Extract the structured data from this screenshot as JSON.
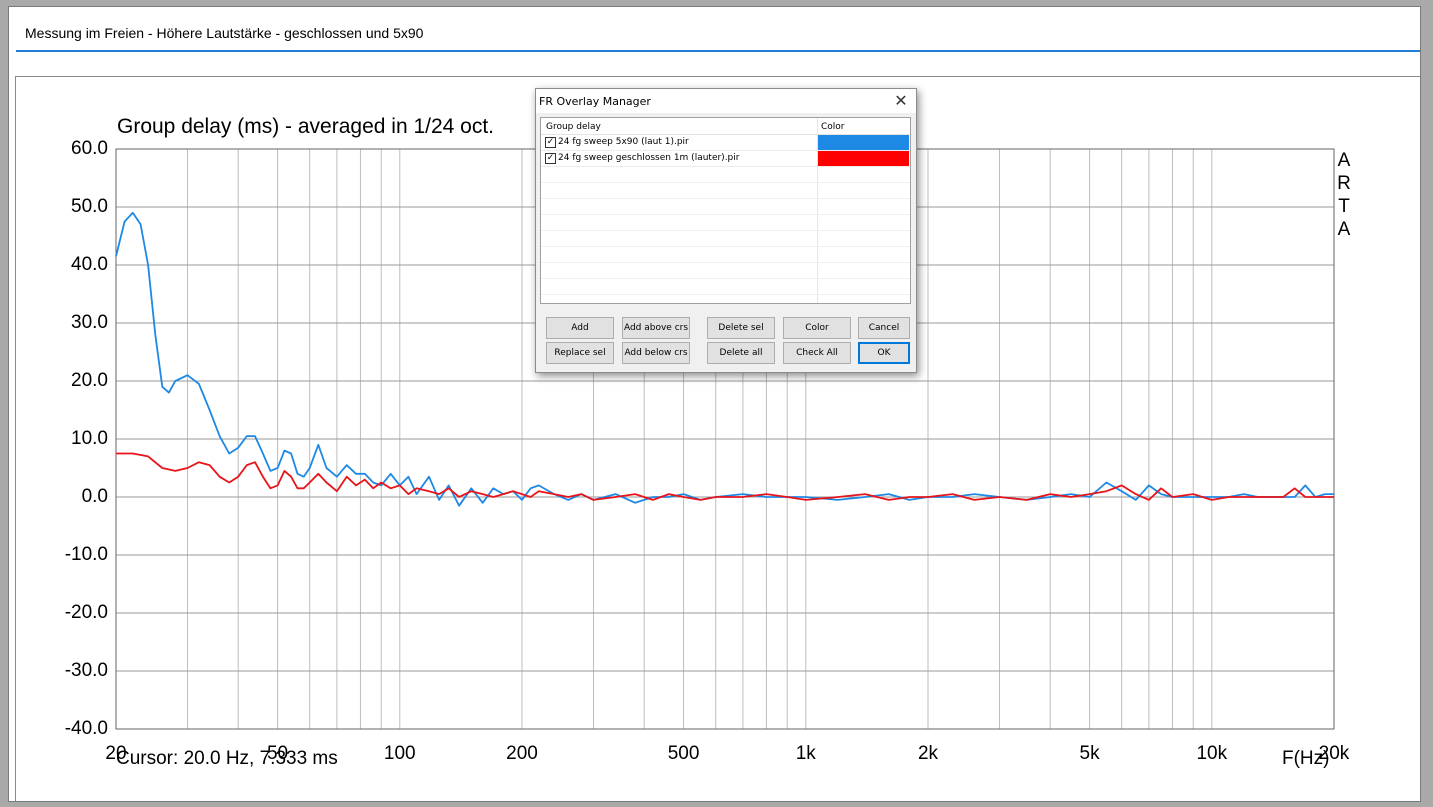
{
  "document": {
    "title": "Messung im Freien - Höhere Lautstärke - geschlossen und 5x90"
  },
  "chart_data": {
    "type": "line",
    "title": "Group delay (ms) - averaged in 1/24 oct.",
    "xlabel": "F(Hz)",
    "ylabel": "",
    "xscale": "log",
    "xlim": [
      20,
      20000
    ],
    "ylim": [
      -40,
      60
    ],
    "grid": true,
    "watermark": "ARTA",
    "yticks": [
      "60.0",
      "50.0",
      "40.0",
      "30.0",
      "20.0",
      "10.0",
      "0.0",
      "-10.0",
      "-20.0",
      "-30.0",
      "-40.0"
    ],
    "xtick_labels": [
      "20",
      "50",
      "100",
      "200",
      "500",
      "1k",
      "2k",
      "5k",
      "10k",
      "20k"
    ],
    "series": [
      {
        "color": "#1e88e5",
        "x": [
          20,
          21,
          22,
          23,
          24,
          25,
          26,
          27,
          28,
          30,
          32,
          34,
          36,
          38,
          40,
          42,
          44,
          46,
          48,
          50,
          52,
          54,
          56,
          58,
          60,
          63,
          66,
          70,
          74,
          78,
          82,
          86,
          90,
          95,
          100,
          105,
          110,
          118,
          125,
          132,
          140,
          150,
          160,
          170,
          180,
          190,
          200,
          210,
          220,
          240,
          260,
          280,
          300,
          340,
          380,
          420,
          460,
          500,
          550,
          600,
          700,
          800,
          900,
          1000,
          1200,
          1400,
          1600,
          1800,
          2000,
          2300,
          2600,
          3000,
          3500,
          4000,
          4500,
          5000,
          5500,
          6000,
          6500,
          7000,
          7500,
          8000,
          9000,
          10000,
          11000,
          12000,
          13000,
          14000,
          15000,
          16000,
          17000,
          18000,
          19000,
          20000
        ],
        "y": [
          41.5,
          47.5,
          49,
          47,
          40,
          28,
          19,
          18,
          20,
          21,
          19.5,
          15,
          10.5,
          7.5,
          8.5,
          10.5,
          10.5,
          7.5,
          4.5,
          5,
          8,
          7.5,
          4,
          3.5,
          5,
          9,
          5,
          3.5,
          5.5,
          4,
          4,
          2.5,
          2,
          4,
          2,
          3.5,
          0.5,
          3.5,
          -0.5,
          2,
          -1.5,
          1.5,
          -1,
          1.5,
          0.5,
          1,
          -0.5,
          1.5,
          2,
          0.5,
          -0.5,
          0.5,
          -0.5,
          0.5,
          -1,
          0,
          0,
          0.5,
          -0.5,
          0,
          0.5,
          0,
          0,
          0,
          -0.5,
          0,
          0.5,
          -0.5,
          0,
          0,
          0.5,
          0,
          -0.5,
          0,
          0.5,
          0,
          2.5,
          1,
          -0.5,
          2,
          0.5,
          0,
          0,
          0,
          0,
          0.5,
          0,
          0,
          0,
          0,
          2,
          0,
          0.5,
          0.5
        ]
      },
      {
        "color": "#e8141a",
        "x": [
          20,
          22,
          24,
          26,
          28,
          30,
          32,
          34,
          36,
          38,
          40,
          42,
          44,
          46,
          48,
          50,
          52,
          54,
          56,
          58,
          60,
          63,
          66,
          70,
          74,
          78,
          82,
          86,
          90,
          95,
          100,
          105,
          110,
          118,
          125,
          132,
          140,
          150,
          160,
          170,
          180,
          190,
          200,
          210,
          220,
          240,
          260,
          280,
          300,
          340,
          380,
          420,
          460,
          500,
          550,
          600,
          700,
          800,
          900,
          1000,
          1200,
          1400,
          1600,
          1800,
          2000,
          2300,
          2600,
          3000,
          3500,
          4000,
          4500,
          5000,
          5500,
          6000,
          6500,
          7000,
          7500,
          8000,
          9000,
          10000,
          11000,
          12000,
          13000,
          14000,
          15000,
          16000,
          17000,
          18000,
          19000,
          20000
        ],
        "y": [
          7.5,
          7.5,
          7,
          5,
          4.5,
          5,
          6,
          5.5,
          3.5,
          2.5,
          3.5,
          5.5,
          6,
          3.5,
          1.5,
          2,
          4.5,
          3.5,
          1.5,
          1.5,
          2.5,
          4,
          2.5,
          1,
          3.5,
          2,
          3,
          1.5,
          2.5,
          1.5,
          2,
          0.5,
          1.5,
          1,
          0.5,
          1.5,
          0,
          1,
          0.5,
          0,
          0.5,
          1,
          0.5,
          0,
          1,
          0.5,
          0,
          0.5,
          -0.5,
          0,
          0.5,
          -0.5,
          0.5,
          0,
          -0.5,
          0,
          0,
          0.5,
          0,
          -0.5,
          0,
          0.5,
          -0.5,
          0,
          0,
          0.5,
          -0.5,
          0,
          -0.5,
          0.5,
          0,
          0.5,
          1,
          2,
          0.5,
          -0.5,
          1.5,
          0,
          0.5,
          -0.5,
          0,
          0,
          0,
          0,
          0,
          1.5,
          0,
          0,
          0,
          0
        ]
      }
    ]
  },
  "cursor_readout": "Cursor: 20.0 Hz, 7.333 ms",
  "dialog": {
    "title": "FR Overlay Manager",
    "close_glyph": "✕",
    "col_name": "Group delay",
    "col_color": "Color",
    "items": [
      {
        "name": "24 fg sweep 5x90 (laut 1).pir",
        "checked": true,
        "check_glyph": "✓",
        "color": "#1e88e5"
      },
      {
        "name": "24 fg sweep geschlossen 1m (lauter).pir",
        "checked": true,
        "check_glyph": "✓",
        "color": "#ff0000"
      }
    ],
    "buttons": {
      "add": "Add",
      "add_above": "Add above crs",
      "delete_sel": "Delete sel",
      "color": "Color",
      "cancel": "Cancel",
      "replace_sel": "Replace sel",
      "add_below": "Add below crs",
      "delete_all": "Delete all",
      "check_all": "Check All",
      "ok": "OK"
    }
  }
}
